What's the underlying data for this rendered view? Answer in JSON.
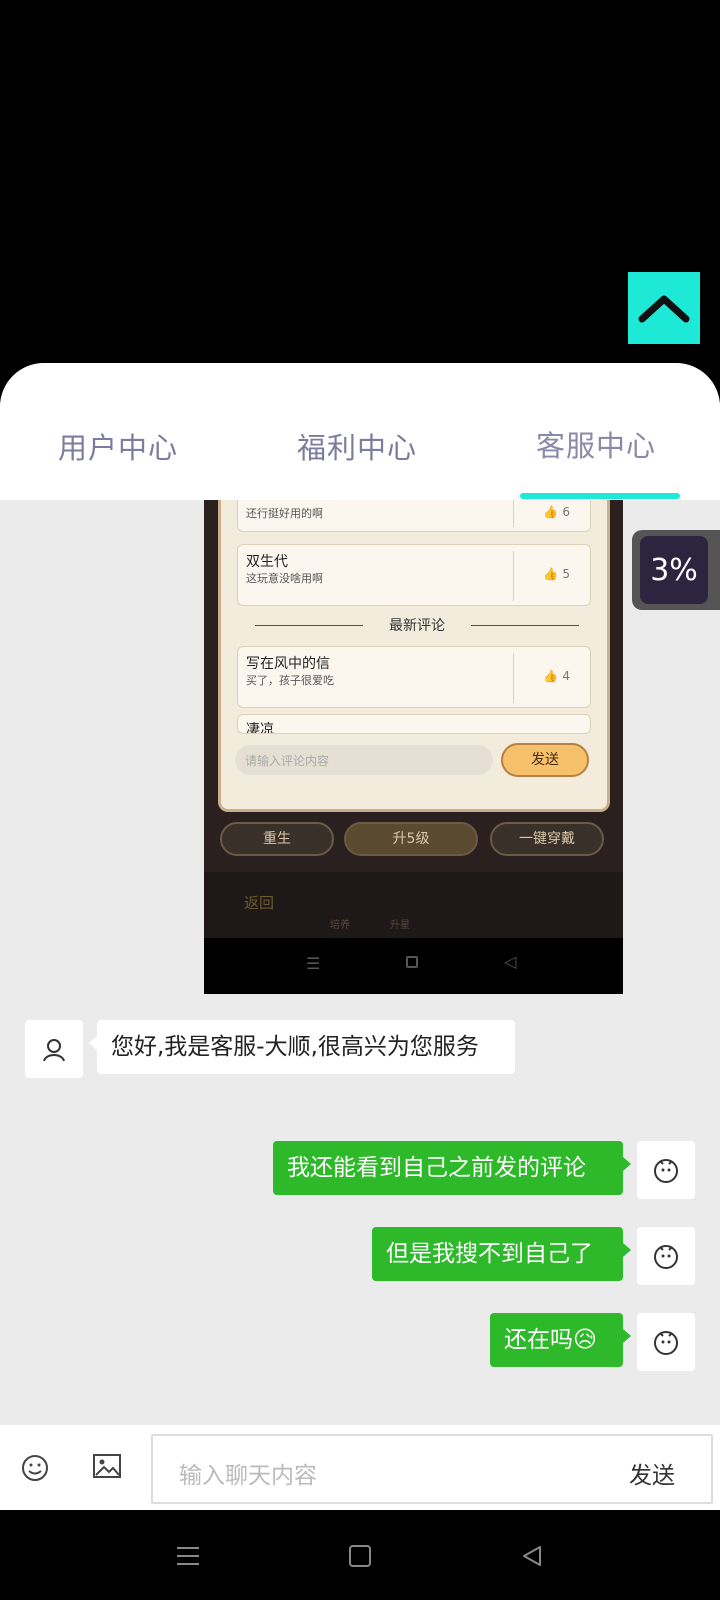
{
  "tabs": [
    {
      "label": "用户中心"
    },
    {
      "label": "福利中心"
    },
    {
      "label": "客服中心"
    }
  ],
  "float_widget": {
    "percent": "3%"
  },
  "shared_screenshot": {
    "comments": [
      {
        "name": "",
        "text": "还行挺好用的啊",
        "likes": "6"
      },
      {
        "name": "双生代",
        "text": "这玩意没啥用啊",
        "likes": "5"
      },
      {
        "name": "写在风中的信",
        "text": "买了，孩子很爱吃",
        "likes": "4"
      }
    ],
    "section_title": "最新评论",
    "partial_name": "凄凉",
    "input_placeholder": "请输入评论内容",
    "send_label": "发送",
    "buttons": [
      "重生",
      "升5级",
      "一键穿戴"
    ],
    "bottom_labels": [
      "返回",
      "培养",
      "升星"
    ]
  },
  "messages": [
    {
      "side": "left",
      "text": "您好,我是客服-大顺,很高兴为您服务"
    },
    {
      "side": "right",
      "text": "我还能看到自己之前发的评论"
    },
    {
      "side": "right",
      "text": "但是我搜不到自己了"
    },
    {
      "side": "right",
      "text": "还在吗😥"
    }
  ],
  "chat_input": {
    "placeholder": "输入聊天内容",
    "send_label": "发送"
  },
  "colors": {
    "accent": "#1ee8d6",
    "my_bubble": "#2db92a",
    "tab_text": "#7c7c9c"
  }
}
